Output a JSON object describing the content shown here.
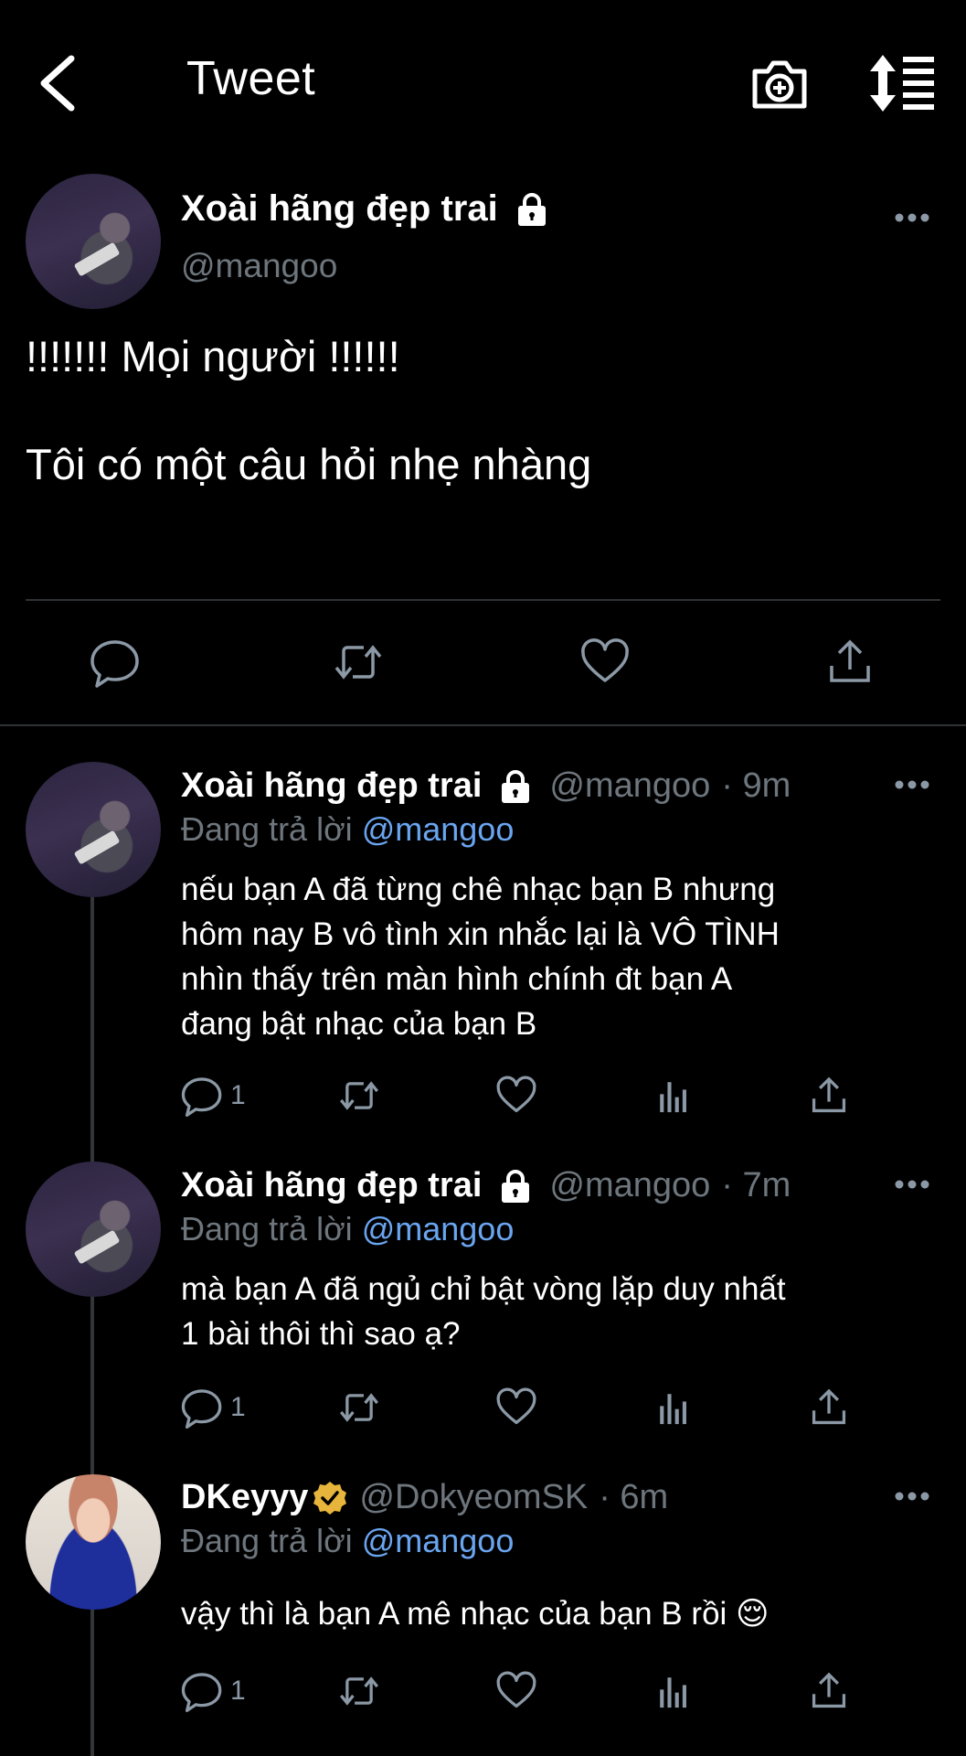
{
  "header": {
    "title": "Tweet",
    "back_icon": "chevron-left-icon",
    "camera_icon": "camera-plus-icon",
    "sort_icon": "sort-icon"
  },
  "main_tweet": {
    "display_name": "Xoài hãng đẹp trai",
    "handle": "@mangoo",
    "text_line1": "!!!!!!! Mọi người !!!!!!",
    "text_line2": "Tôi có một câu hỏi nhẹ nhàng",
    "actions": [
      "reply-icon",
      "retweet-icon",
      "like-icon",
      "share-icon"
    ]
  },
  "replies": [
    {
      "display_name": "Xoài hãng đẹp trai",
      "handle": "@mangoo",
      "time": "· 9m",
      "replying_prefix": "Đang trả lời",
      "replying_to": "@mangoo",
      "lines": [
        "nếu bạn A đã từng chê nhạc bạn B nhưng",
        "hôm nay B vô tình xin nhắc lại là VÔ TÌNH",
        "nhìn thấy trên màn hình chính đt bạn A",
        "đang bật nhạc của bạn B"
      ],
      "reply_count": "1"
    },
    {
      "display_name": "Xoài hãng đẹp trai",
      "handle": "@mangoo",
      "time": "· 7m",
      "replying_prefix": "Đang trả lời",
      "replying_to": "@mangoo",
      "lines": [
        "mà bạn A đã ngủ chỉ bật vòng lặp duy nhất",
        "1 bài thôi thì sao ạ?"
      ],
      "reply_count": "1"
    },
    {
      "display_name": "DKeyyy",
      "handle": "@DokyeomSK",
      "time": "· 6m",
      "replying_prefix": "Đang trả lời",
      "replying_to": "@mangoo",
      "lines": [
        "vậy thì là bạn A mê nhạc của bạn B rồi 😌"
      ],
      "reply_count": "1"
    }
  ],
  "colors": {
    "background": "#000000",
    "mention": "#6aa5f0",
    "muted": "#6e767d",
    "verified": "#e7b53b"
  }
}
